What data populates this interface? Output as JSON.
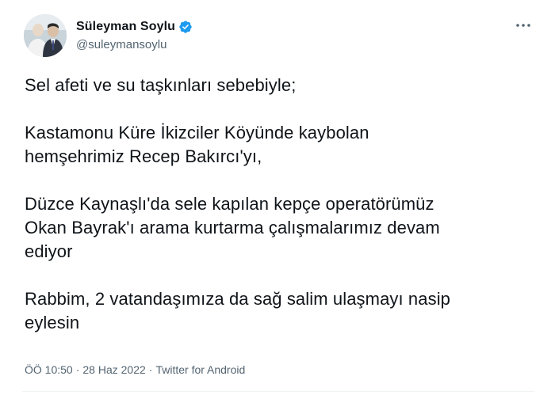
{
  "author": {
    "display_name": "Süleyman Soylu",
    "handle": "@suleymansoylu",
    "verified": true
  },
  "more_icon": "more-horizontal-icon",
  "tweet": {
    "paragraphs": [
      [
        "Sel afeti ve su taşkınları sebebiyle;"
      ],
      [
        "Kastamonu Küre İkizciler Köyünde kaybolan",
        "hemşehrimiz Recep Bakırcı'yı,"
      ],
      [
        "Düzce Kaynaşlı'da sele kapılan kepçe operatörümüz",
        "Okan Bayrak'ı arama kurtarma çalışmalarımız devam",
        "ediyor"
      ],
      [
        "Rabbim, 2 vatandaşımıza da sağ salim ulaşmayı nasip",
        "eylesin"
      ]
    ]
  },
  "meta": {
    "time": "ÖÖ 10:50",
    "separator": "·",
    "date": "28 Haz 2022",
    "source": "Twitter for Android"
  },
  "colors": {
    "text": "#0f1419",
    "secondary": "#536471",
    "verified": "#1d9bf0"
  }
}
